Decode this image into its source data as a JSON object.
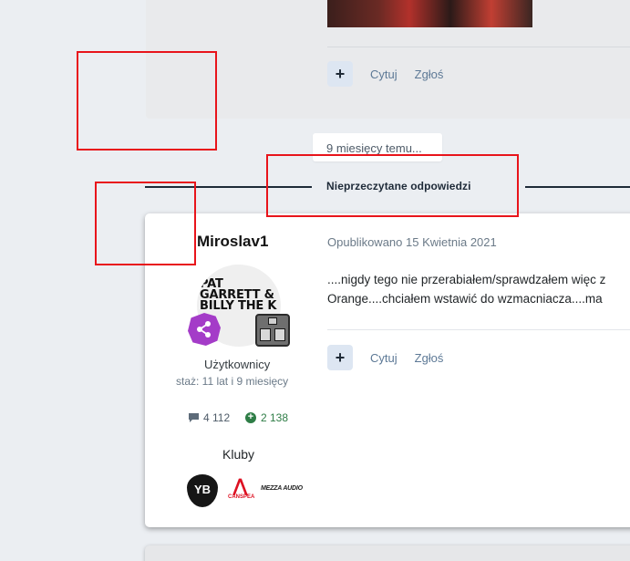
{
  "previous_post": {
    "actions": {
      "plus": "+",
      "quote": "Cytuj",
      "report": "Zgłoś"
    }
  },
  "time_badge": "9 miesięcy temu...",
  "unread_separator": "Nieprzeczytane odpowiedzi",
  "post": {
    "author": {
      "name": "Miroslav1",
      "avatar_text": "PAT GARRETT & BILLY THE K",
      "group": "Użytkownicy",
      "tenure": "staż: 11 lat i 9 miesięcy",
      "comment_count": "4 112",
      "reputation": "2 138",
      "clubs_label": "Kluby",
      "clubs": [
        {
          "name": "YB",
          "icon": "yb-club-icon"
        },
        {
          "name": "CANSPEA",
          "icon": "canspeak-club-icon"
        },
        {
          "name": "MEZZA AUDIO",
          "icon": "mezza-club-icon"
        }
      ]
    },
    "date": "Opublikowano 15 Kwietnia 2021",
    "body_lines": [
      "....nigdy tego nie przerabiałem/sprawdzałem więc z",
      "Orange....chciałem wstawić do wzmacniacza....ma"
    ],
    "actions": {
      "plus": "+",
      "quote": "Cytuj",
      "report": "Zgłoś"
    }
  },
  "colors": {
    "background": "#ebeef2",
    "link": "#5d7996",
    "reputation_green": "#2e7d46",
    "annotation_red": "#e8141b"
  }
}
